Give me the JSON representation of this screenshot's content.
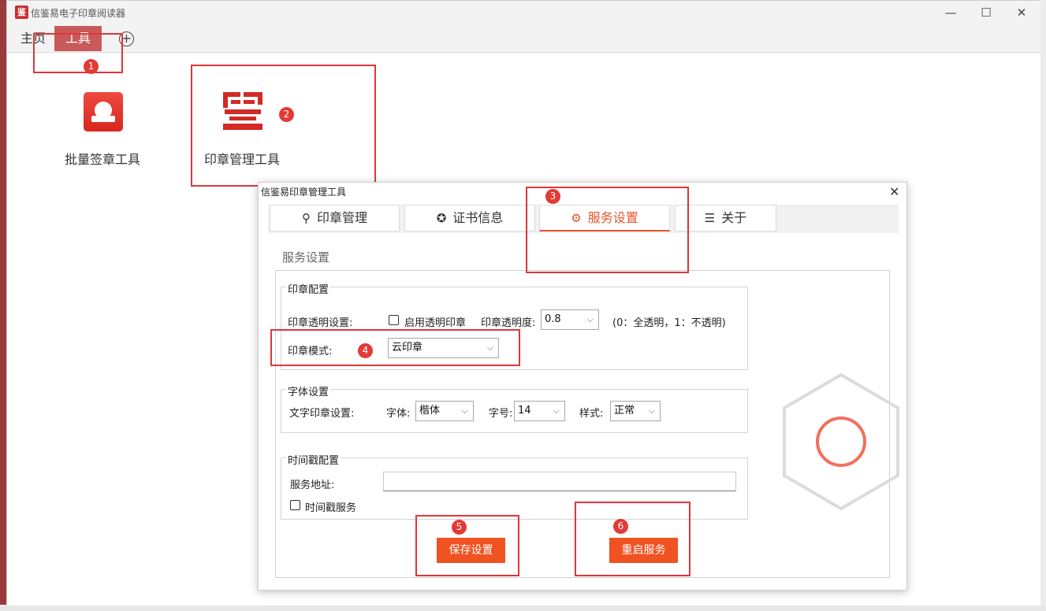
{
  "app": {
    "title": "信鉴易电子印章阅读器",
    "logo_text": "鉴"
  },
  "window_controls": {
    "minimize": "—",
    "maximize": "☐",
    "close": "✕"
  },
  "tabs": {
    "home": "主页",
    "tools": "工具",
    "add": "+"
  },
  "tools": [
    {
      "label": "批量签章工具",
      "icon": "stamp-icon"
    },
    {
      "label": "印章管理工具",
      "icon": "seal-logo-icon"
    }
  ],
  "annotations": [
    "1",
    "2",
    "3",
    "4",
    "5",
    "6"
  ],
  "dialog": {
    "title": "信鉴易印章管理工具",
    "close": "✕",
    "tabs": [
      {
        "label": "印章管理",
        "icon": "stamp-icon",
        "glyph": "⚲"
      },
      {
        "label": "证书信息",
        "icon": "certificate-icon",
        "glyph": "✪"
      },
      {
        "label": "服务设置",
        "icon": "gear-icon",
        "glyph": "⚙"
      },
      {
        "label": "关于",
        "icon": "document-icon",
        "glyph": "☰"
      }
    ],
    "active_tab": "服务设置",
    "section_title": "服务设置",
    "seal_config": {
      "group_title": "印章配置",
      "transparency_label": "印章透明设置:",
      "enable_transparent_label": "启用透明印章",
      "enable_transparent_checked": false,
      "opacity_label": "印章透明度:",
      "opacity_value": "0.8",
      "opacity_hint": "(0：全透明，1：不透明)",
      "mode_label": "印章模式:",
      "mode_value": "云印章"
    },
    "font_config": {
      "group_title": "字体设置",
      "text_seal_label": "文字印章设置:",
      "font_label": "字体:",
      "font_value": "楷体",
      "size_label": "字号:",
      "size_value": "14",
      "style_label": "样式:",
      "style_value": "正常"
    },
    "timestamp_config": {
      "group_title": "时间戳配置",
      "service_url_label": "服务地址:",
      "service_url_value": "",
      "timestamp_service_label": "时间戳服务",
      "timestamp_service_checked": false
    },
    "save_button": "保存设置",
    "restart_button": "重启服务"
  },
  "colors": {
    "accent": "#f05222",
    "annotation": "#e0363a",
    "tab_active_bg": "#c85a5a"
  }
}
